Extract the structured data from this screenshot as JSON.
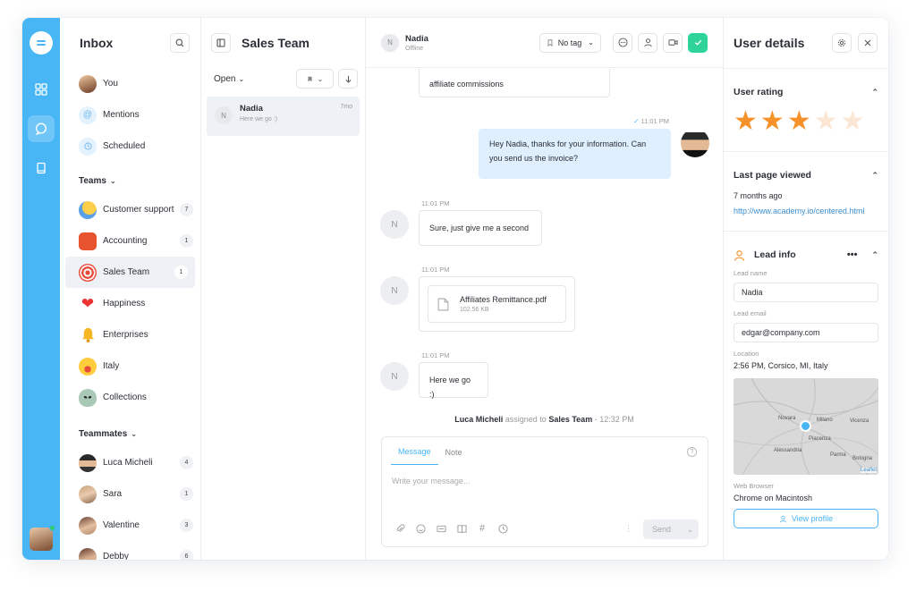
{
  "inbox": {
    "title": "Inbox",
    "items": [
      {
        "label": "You"
      },
      {
        "label": "Mentions"
      },
      {
        "label": "Scheduled"
      }
    ],
    "teams_label": "Teams",
    "teams": [
      {
        "label": "Customer support",
        "count": "7"
      },
      {
        "label": "Accounting",
        "count": "1"
      },
      {
        "label": "Sales Team",
        "count": "1"
      },
      {
        "label": "Happiness",
        "count": ""
      },
      {
        "label": "Enterprises",
        "count": ""
      },
      {
        "label": "Italy",
        "count": ""
      },
      {
        "label": "Collections",
        "count": ""
      }
    ],
    "teammates_label": "Teammates",
    "teammates": [
      {
        "label": "Luca Micheli",
        "count": "4"
      },
      {
        "label": "Sara",
        "count": "1"
      },
      {
        "label": "Valentine",
        "count": "3"
      },
      {
        "label": "Debby",
        "count": "6"
      }
    ]
  },
  "convlist": {
    "title": "Sales Team",
    "filter": "Open",
    "conversations": [
      {
        "initial": "N",
        "name": "Nadia",
        "preview": "Here we go :)",
        "time": "7mo"
      }
    ]
  },
  "chat": {
    "contact": {
      "initial": "N",
      "name": "Nadia",
      "status": "Offline"
    },
    "tag": "No tag",
    "messages": {
      "m0": "affiliate commissions",
      "m1_time": "11:01 PM",
      "m1": "Hey Nadia, thanks for your information. Can you send us the invoice?",
      "m2_time": "11:01 PM",
      "m2": "Sure, just give me a second",
      "m3_time": "11:01 PM",
      "m3_file": "Affiliates Remittance.pdf",
      "m3_size": "102.56 KB",
      "m4_time": "11:01 PM",
      "m4": "Here we go :)"
    },
    "system": {
      "actor": "Luca Micheli",
      "action": "assigned to",
      "target": "Sales Team",
      "time": "- 12:32 PM"
    },
    "composer": {
      "tab_message": "Message",
      "tab_note": "Note",
      "placeholder": "Write your message...",
      "send": "Send"
    }
  },
  "details": {
    "title": "User details",
    "rating_title": "User rating",
    "rating": 3,
    "rating_max": 5,
    "last_page_title": "Last page viewed",
    "last_page_when": "7 months ago",
    "last_page_url": "http://www.academy.io/centered.html",
    "lead_title": "Lead info",
    "lead_name_label": "Lead name",
    "lead_name": "Nadia",
    "lead_email_label": "Lead email",
    "lead_email": "edgar@company.com",
    "location_label": "Location",
    "location": "2:56 PM, Corsico, MI, Italy",
    "map_labels": {
      "a": "Novara",
      "b": "Milano",
      "c": "Alessandria",
      "d": "Piacenza",
      "e": "Parma",
      "f": "Bologna",
      "g": "Vicenza",
      "h": "Leaflet"
    },
    "browser_label": "Web Browser",
    "browser": "Chrome on Macintosh",
    "view_profile": "View profile"
  },
  "colors": {
    "accent": "#48b6f5",
    "star_on": "#f5922a",
    "star_off": "#fbe6d3",
    "green": "#2ed39a"
  }
}
